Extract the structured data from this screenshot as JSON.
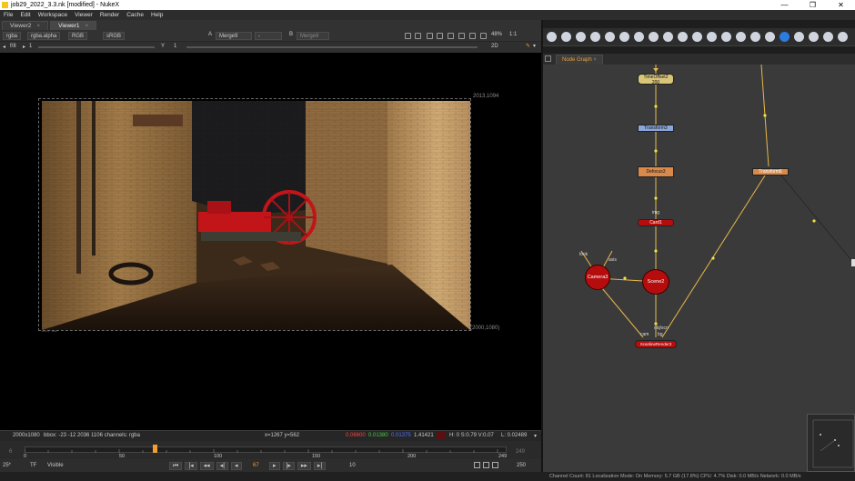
{
  "window": {
    "title": "job29_2022_3.3.nk [modified] - NukeX",
    "controls": [
      "—",
      "❐",
      "✕"
    ]
  },
  "menu": [
    "File",
    "Edit",
    "Workspace",
    "Viewer",
    "Render",
    "Cache",
    "Help"
  ],
  "viewer_tabs": [
    {
      "label": "Viewer2",
      "active": false
    },
    {
      "label": "Viewer1",
      "active": true
    }
  ],
  "viewer_controls": {
    "channels": "rgba",
    "alpha": "rgba.alpha",
    "display": "RGB",
    "colorspace": "sRGB",
    "input_a_letter": "A",
    "input_a": "Merge9",
    "op": "-",
    "input_b_letter": "B",
    "input_b": "Merge9",
    "zoom": "48%",
    "proxy": "1:1",
    "fstop": "f/8",
    "gain": "1",
    "gamma_label": "Y",
    "gamma": "1",
    "view_mode": "2D"
  },
  "viewer": {
    "top_right_label": "2013,1094",
    "bottom_right_label": "(2000,1080)",
    "bottom_left_label": "-23,-12"
  },
  "info_bar": {
    "format": "2000x1080",
    "bbox": "bbox: -23 -12 2036 1106 channels: rgba",
    "coords": "x=1267 y=562",
    "r": "0.06600",
    "g": "0.01380",
    "b": "0.01375",
    "a": "1.41421",
    "hsv": "H: 0 S:0.79 V:0.07",
    "luminance": "L: 0.02489"
  },
  "timeline": {
    "in": "6",
    "out": "249",
    "ticks": [
      "0",
      "50",
      "100",
      "150",
      "200",
      "249"
    ],
    "current": "67",
    "range_end": "250"
  },
  "transport": {
    "fps": "25*",
    "tf": "TF",
    "visible": "Visible",
    "frame": "67",
    "increment": "10"
  },
  "node_graph": {
    "tab_label": "Node Graph",
    "nodes": {
      "timeoffset": "TimeOffset2\n200",
      "transform": "Transform3",
      "defocus": "Defocus3",
      "card": "Card1",
      "camera": "Camera3",
      "scene": "Scene2",
      "render": "ScanlineRender3",
      "far_node": "Transform6"
    },
    "labels": {
      "img": "img",
      "look": "look",
      "axis": "axis",
      "obj_scn": "obj/scn",
      "cam": "cam",
      "bg": "bg"
    }
  },
  "status": "Channel Count: 81  Localization Mode: On  Memory: 5.7 GB (17.8%)  CPU: 4.7%  Disk: 0.0 MB/s  Network: 0.0 MB/s",
  "colors": {
    "accent": "#f0a030",
    "node_red": "#b50d0d",
    "node_orange": "#d98a4a",
    "node_blue": "#8ba6d8",
    "node_yellow": "#d8c57a",
    "edge": "#e8b84a"
  }
}
